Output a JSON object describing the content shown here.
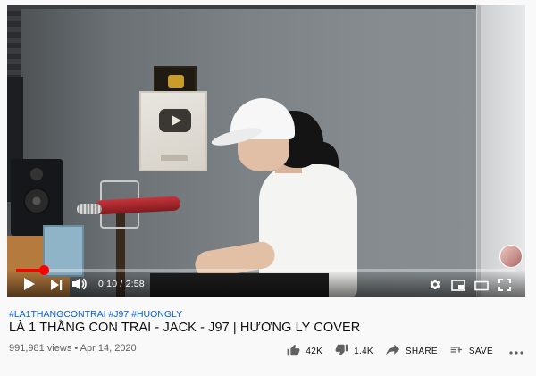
{
  "player": {
    "current_time": "0:10",
    "duration": "2:58",
    "time_display": "0:10 / 2:58",
    "progress": 0.056,
    "icons": {
      "play": "play-icon",
      "next": "next-icon",
      "volume": "volume-icon",
      "settings": "gear-icon",
      "miniplayer": "miniplayer-icon",
      "theater": "theater-icon",
      "fullscreen": "fullscreen-icon"
    },
    "colors": {
      "progress": "#ff0000"
    }
  },
  "video": {
    "hashtags": "#LA1THANGCONTRAI #J97 #HUONGLY",
    "title": "LÀ 1 THẰNG CON TRAI - JACK - J97 | HƯƠNG LY COVER",
    "views": "991,981 views",
    "date": "Apr 14, 2020",
    "meta": "991,981 views • Apr 14, 2020"
  },
  "actions": {
    "like": {
      "label": "42K",
      "icon": "thumbs-up-icon"
    },
    "dislike": {
      "label": "1.4K",
      "icon": "thumbs-down-icon"
    },
    "share": {
      "label": "SHARE",
      "icon": "share-icon"
    },
    "save": {
      "label": "SAVE",
      "icon": "playlist-add-icon"
    },
    "more": {
      "icon": "more-icon"
    }
  },
  "colors": {
    "link": "#065fd4",
    "text": "#0f0f0f",
    "secondary": "#606060",
    "background": "#f9f9f9"
  }
}
